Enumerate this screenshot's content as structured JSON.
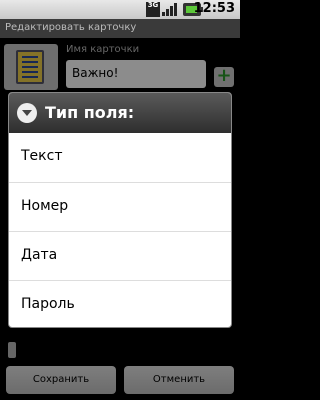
{
  "status": {
    "network": "3G",
    "time": "12:53"
  },
  "window": {
    "title": "Редактировать карточку"
  },
  "card": {
    "name_label": "Имя карточки",
    "name_value": "Важно!"
  },
  "buttons": {
    "save": "Сохранить",
    "cancel": "Отменить",
    "add": "+"
  },
  "dialog": {
    "title": "Тип поля:",
    "options": [
      "Текст",
      "Номер",
      "Дата",
      "Пароль"
    ]
  },
  "colors": {
    "add_icon": "#2a9a2a",
    "dialog_header": "#3a3a3a",
    "dialog_bg": "#ffffff"
  }
}
